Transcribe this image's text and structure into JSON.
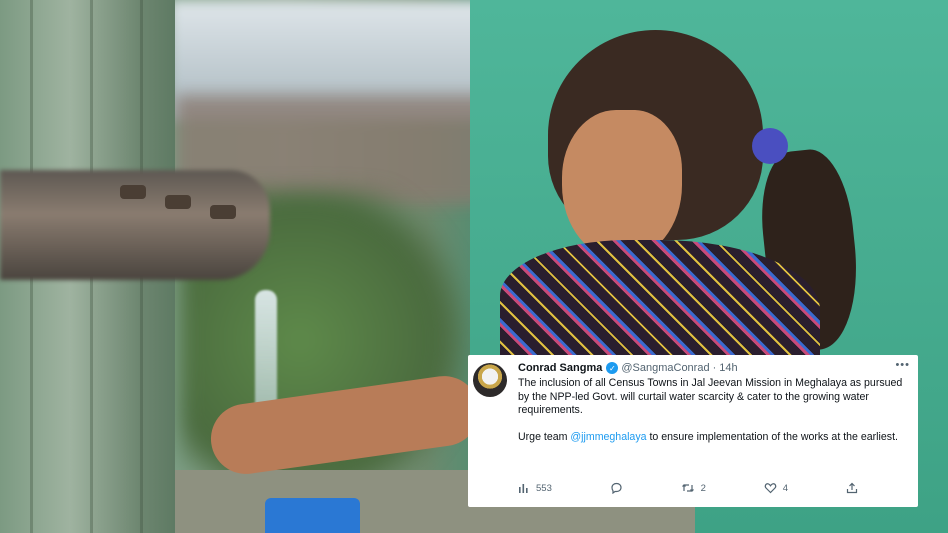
{
  "tweet": {
    "author_name": "Conrad Sangma",
    "handle": "@SangmaConrad",
    "time": "14h",
    "text_line1": "The inclusion of all Census Towns in Jal Jeevan Mission in Meghalaya as pursued by the NPP-led Govt. will curtail water scarcity & cater to the growing water requirements.",
    "text2_prefix": "Urge team ",
    "mention": "@jjmmeghalaya",
    "text2_suffix": " to ensure implementation of the works at the earliest.",
    "views": "553",
    "retweets": "2",
    "likes": "4",
    "more": "•••",
    "separator": "·"
  },
  "icons": {
    "verified": "verified-badge-icon",
    "views": "bar-chart-icon",
    "reply": "reply-icon",
    "retweet": "retweet-icon",
    "like": "heart-icon",
    "share": "share-icon"
  },
  "colors": {
    "link": "#1d9bf0",
    "text": "#0f1419",
    "muted": "#536471"
  }
}
